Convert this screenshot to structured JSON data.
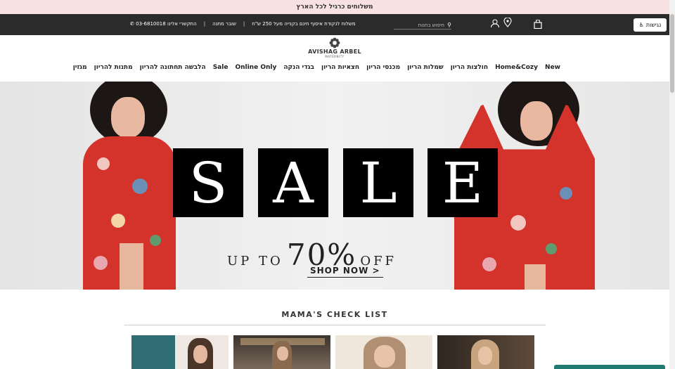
{
  "announcement": "משלוחים כרגיל לכל הארץ",
  "topbar": {
    "accessibility_label": "נגישות",
    "search_placeholder": "חיפוש בחנות",
    "promo_shipping": "משלוח לנקודת איסוף חינם בקנייה מעל 250 ש\"ח",
    "promo_voucher": "שובר מתנה",
    "contact_text": "התקשרי אלינו 03-6810018",
    "separator": "|"
  },
  "logo": {
    "name": "AVISHAG ARBEL",
    "sub": "MATERNITY"
  },
  "nav": {
    "items": [
      "New",
      "Home&Cozy",
      "חולצות הריון",
      "שמלות הריון",
      "מכנסי הריון",
      "חצאיות הריון",
      "בגדי הנקה",
      "Online Only",
      "Sale",
      "הלבשה תחתונה להריון",
      "מתנות להריון",
      "מגזין"
    ]
  },
  "hero": {
    "letters": [
      "S",
      "A",
      "L",
      "E"
    ],
    "up_to": "UP TO",
    "percent": "70%",
    "off": "OFF",
    "cta": "SHOP NOW >"
  },
  "checklist": {
    "title": "MAMA'S CHECK LIST"
  },
  "colors": {
    "announcement_bg": "#f7e1e1",
    "topbar_bg": "#2b2b2b",
    "robe_red": "#d3332a",
    "chat_teal": "#1f7a72"
  }
}
